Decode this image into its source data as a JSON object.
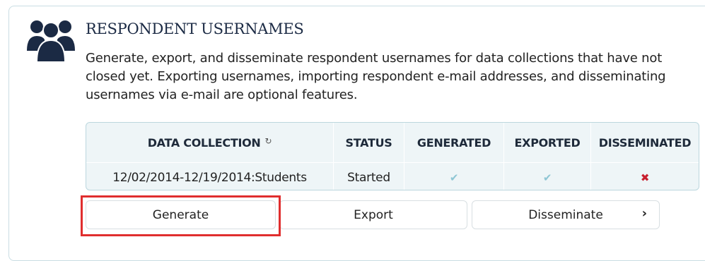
{
  "section": {
    "title": "RESPONDENT USERNAMES",
    "description": "Generate, export, and disseminate respondent usernames for data collections that have not closed yet. Exporting usernames, importing respondent e-mail addresses, and disseminating usernames via e-mail are optional features.",
    "icon": "users-group-icon"
  },
  "table": {
    "headers": {
      "data_collection": "DATA COLLECTION",
      "status": "STATUS",
      "generated": "GENERATED",
      "exported": "EXPORTED",
      "disseminated": "DISSEMINATED"
    },
    "sort_icon": "↻",
    "rows": [
      {
        "data_collection": "12/02/2014-12/19/2014:Students",
        "status": "Started",
        "generated": "✔",
        "exported": "✔",
        "disseminated": "✖"
      }
    ]
  },
  "buttons": {
    "generate": "Generate",
    "export": "Export",
    "disseminate": "Disseminate",
    "chevron": "›"
  },
  "colors": {
    "accent": "#1b2a44",
    "check": "#8ec6d4",
    "cross": "#c8202f",
    "highlight": "#e02e2e"
  }
}
